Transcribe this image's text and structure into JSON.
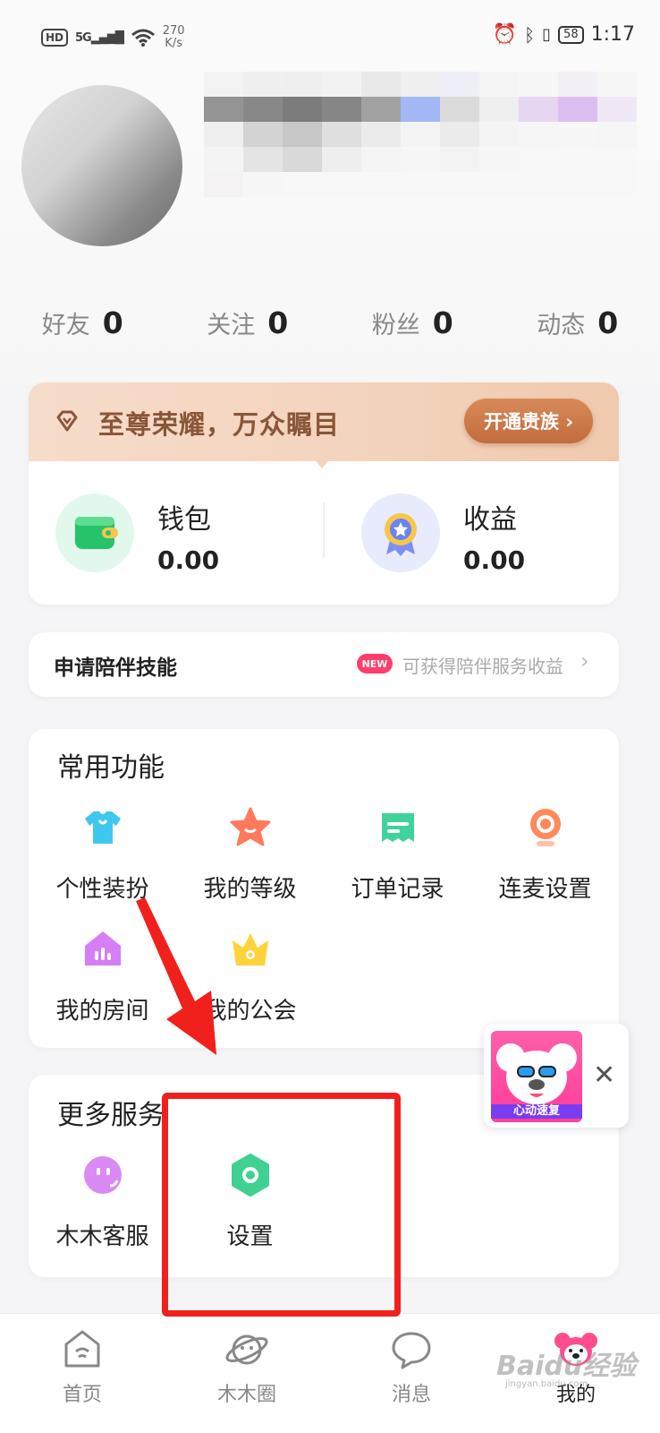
{
  "status_bar": {
    "left_badge": "HD",
    "network": "5G",
    "speed_value": "270",
    "speed_unit": "K/s",
    "battery": "58",
    "time": "1:17"
  },
  "stats": [
    {
      "label": "好友",
      "value": "0"
    },
    {
      "label": "关注",
      "value": "0"
    },
    {
      "label": "粉丝",
      "value": "0"
    },
    {
      "label": "动态",
      "value": "0"
    }
  ],
  "vip": {
    "slogan": "至尊荣耀，万众瞩目",
    "button": "开通贵族 ›"
  },
  "wallet": {
    "title": "钱包",
    "value": "0.00"
  },
  "income": {
    "title": "收益",
    "value": "0.00"
  },
  "companion": {
    "title": "申请陪伴技能",
    "badge": "NEW",
    "subtitle": "可获得陪伴服务收益",
    "chevron": "›"
  },
  "common_functions": {
    "title": "常用功能",
    "items": [
      {
        "label": "个性装扮",
        "icon": "tshirt-icon"
      },
      {
        "label": "我的等级",
        "icon": "star-icon"
      },
      {
        "label": "订单记录",
        "icon": "order-icon"
      },
      {
        "label": "连麦设置",
        "icon": "webcam-icon"
      },
      {
        "label": "我的房间",
        "icon": "room-icon"
      },
      {
        "label": "我的公会",
        "icon": "crown-icon"
      }
    ]
  },
  "more_services": {
    "title": "更多服务",
    "items": [
      {
        "label": "木木客服",
        "icon": "smiley-icon"
      },
      {
        "label": "设置",
        "icon": "gear-icon"
      }
    ]
  },
  "ad": {
    "text": "心动速复",
    "close": "✕"
  },
  "tabbar": [
    {
      "label": "首页",
      "icon": "home-icon"
    },
    {
      "label": "木木圈",
      "icon": "planet-icon"
    },
    {
      "label": "消息",
      "icon": "message-icon"
    },
    {
      "label": "我的",
      "icon": "koala-icon",
      "active": true
    }
  ],
  "watermark": {
    "text": "Baidu经验",
    "sub": "jingyan.baidu.com"
  },
  "colors": {
    "accent_red": "#f0201c",
    "vip_brown": "#8a5638",
    "new_badge": "#ff3d6a"
  }
}
